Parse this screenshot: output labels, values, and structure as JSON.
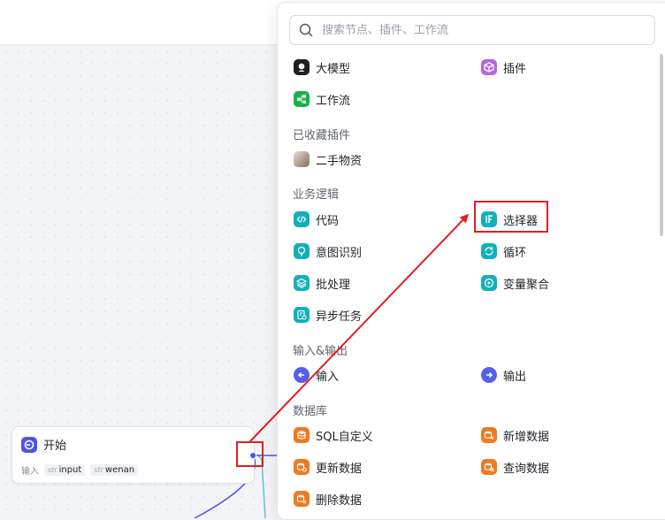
{
  "canvas": {
    "start_node": {
      "title": "开始",
      "input_label": "输入",
      "params": [
        {
          "type": "str",
          "name": "input"
        },
        {
          "type": "str",
          "name": "wenan"
        }
      ]
    }
  },
  "popup": {
    "search": {
      "placeholder": "搜索节点、插件、工作流",
      "value": ""
    },
    "top_items": [
      {
        "label": "大模型",
        "icon": "llm-icon",
        "color": "#1f1f1f"
      },
      {
        "label": "插件",
        "icon": "plugin-cube-icon",
        "color": "#b565e6"
      },
      {
        "label": "工作流",
        "icon": "workflow-icon",
        "color": "#17b34a"
      }
    ],
    "sections": {
      "favorites": {
        "title": "已收藏插件",
        "items": [
          {
            "label": "二手物资",
            "icon": "avatar-thumbnail"
          }
        ]
      },
      "logic": {
        "title": "业务逻辑",
        "items": [
          {
            "label": "代码",
            "icon": "code-icon"
          },
          {
            "label": "选择器",
            "icon": "if-selector-icon"
          },
          {
            "label": "意图识别",
            "icon": "intent-bulb-icon"
          },
          {
            "label": "循环",
            "icon": "loop-icon"
          },
          {
            "label": "批处理",
            "icon": "batch-layers-icon"
          },
          {
            "label": "变量聚合",
            "icon": "aggregate-icon"
          },
          {
            "label": "异步任务",
            "icon": "async-task-icon"
          }
        ]
      },
      "io": {
        "title": "输入&输出",
        "items": [
          {
            "label": "输入",
            "icon": "input-arrow-icon"
          },
          {
            "label": "输出",
            "icon": "output-arrow-icon"
          }
        ]
      },
      "database": {
        "title": "数据库",
        "items": [
          {
            "label": "SQL自定义",
            "icon": "database-icon"
          },
          {
            "label": "新增数据",
            "icon": "database-add-icon"
          },
          {
            "label": "更新数据",
            "icon": "database-update-icon"
          },
          {
            "label": "查询数据",
            "icon": "database-query-icon"
          },
          {
            "label": "删除数据",
            "icon": "database-delete-icon"
          }
        ]
      }
    }
  },
  "colors": {
    "highlight": "#e02020",
    "teal": "#13b0b8",
    "orange": "#f0791e",
    "indigo": "#5560e6"
  }
}
